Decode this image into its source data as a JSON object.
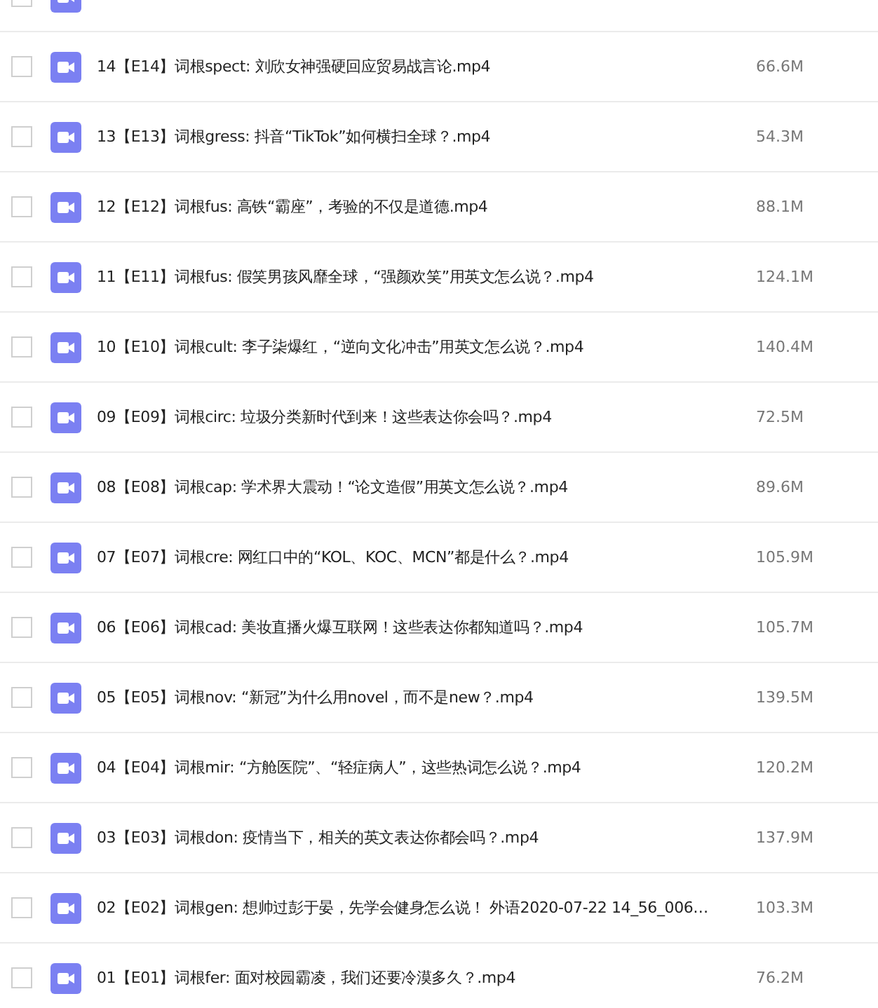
{
  "top_cut_row": {
    "checked": false
  },
  "files": [
    {
      "name": "14【E14】词根spect: 刘欣女神强硬回应贸易战言论.mp4",
      "size": "66.6M",
      "checked": false
    },
    {
      "name": "13【E13】词根gress: 抖音“TikTok”如何横扫全球？.mp4",
      "size": "54.3M",
      "checked": false
    },
    {
      "name": "12【E12】词根fus: 高铁“霸座”，考验的不仅是道德.mp4",
      "size": "88.1M",
      "checked": false
    },
    {
      "name": "11【E11】词根fus: 假笑男孩风靡全球，“强颜欢笑”用英文怎么说？.mp4",
      "size": "124.1M",
      "checked": false
    },
    {
      "name": "10【E10】词根cult: 李子柒爆红，“逆向文化冲击”用英文怎么说？.mp4",
      "size": "140.4M",
      "checked": false
    },
    {
      "name": "09【E09】词根circ: 垃圾分类新时代到来！这些表达你会吗？.mp4",
      "size": "72.5M",
      "checked": false
    },
    {
      "name": "08【E08】词根cap: 学术界大震动！“论文造假”用英文怎么说？.mp4",
      "size": "89.6M",
      "checked": false
    },
    {
      "name": "07【E07】词根cre: 网红口中的“KOL、KOC、MCN”都是什么？.mp4",
      "size": "105.9M",
      "checked": false
    },
    {
      "name": "06【E06】词根cad: 美妆直播火爆互联网！这些表达你都知道吗？.mp4",
      "size": "105.7M",
      "checked": false
    },
    {
      "name": "05【E05】词根nov: “新冠”为什么用novel，而不是new？.mp4",
      "size": "139.5M",
      "checked": false
    },
    {
      "name": "04【E04】词根mir: “方舱医院”、“轻症病人”，这些热词怎么说？.mp4",
      "size": "120.2M",
      "checked": false
    },
    {
      "name": "03【E03】词根don: 疫情当下，相关的英文表达你都会吗？.mp4",
      "size": "137.9M",
      "checked": false
    },
    {
      "name": "02【E02】词根gen: 想帅过彭于晏，先学会健身怎么说！ 外语2020-07-22 14_56_006…",
      "size": "103.3M",
      "checked": false
    },
    {
      "name": "01【E01】词根fer: 面对校园霸凌，我们还要冷漠多久？.mp4",
      "size": "76.2M",
      "checked": false
    }
  ]
}
